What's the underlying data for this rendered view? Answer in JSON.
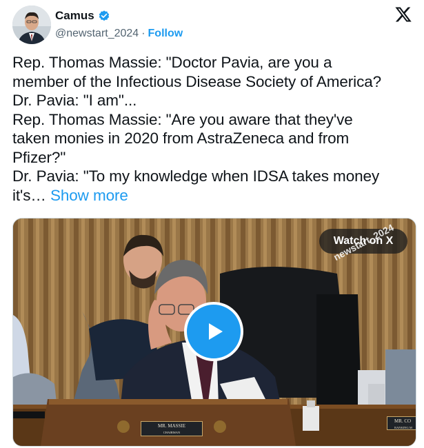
{
  "author": {
    "display_name": "Camus",
    "handle": "@newstart_2024",
    "separator": "·",
    "follow_label": "Follow",
    "verified_icon": "verified-badge-icon"
  },
  "brand": {
    "logo": "x-logo-icon"
  },
  "tweet": {
    "lines": [
      "Rep. Thomas Massie: \"Doctor Pavia, are you a",
      "member of the Infectious Disease Society of America?",
      "Dr. Pavia: \"I am\"...",
      "Rep. Thomas Massie: \"Are you aware that they've",
      "taken monies in 2020 from AstraZeneca and from",
      "Pfizer?\"",
      "Dr. Pavia: \"To my knowledge when IDSA takes money"
    ],
    "last_line": "it's…",
    "show_more_label": "Show more"
  },
  "media": {
    "watch_label": "Watch on X",
    "watermark": "newstart_2024",
    "nameplate_main": "MR. MASSIE",
    "nameplate_sub": "CHAIRMAN",
    "nameplate2_main": "MR. CO",
    "nameplate2_sub": "RANKING M"
  },
  "colors": {
    "accent": "#1d9bf0",
    "text": "#0f1419",
    "muted": "#536471"
  }
}
